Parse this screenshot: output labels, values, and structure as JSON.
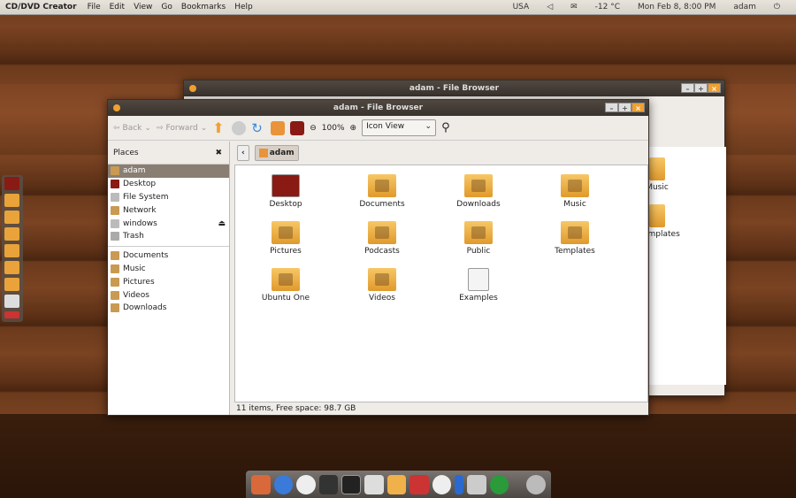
{
  "topbar": {
    "app": "CD/DVD Creator",
    "menus": [
      "File",
      "Edit",
      "View",
      "Go",
      "Bookmarks",
      "Help"
    ],
    "keyboard": "USA",
    "weather": "-12 °C",
    "clock": "Mon Feb  8,  8:00 PM",
    "user": "adam"
  },
  "back_window": {
    "title": "adam - File Browser",
    "items": [
      "Music",
      "Templates"
    ]
  },
  "window": {
    "title": "adam - File Browser",
    "toolbar": {
      "back": "Back",
      "forward": "Forward",
      "zoom": "100%",
      "view": "Icon View"
    },
    "sidebar": {
      "header": "Places",
      "places": [
        "adam",
        "Desktop",
        "File System",
        "Network",
        "windows",
        "Trash"
      ],
      "bookmarks": [
        "Documents",
        "Music",
        "Pictures",
        "Videos",
        "Downloads"
      ]
    },
    "path": "adam",
    "items": [
      "Desktop",
      "Documents",
      "Downloads",
      "Music",
      "Pictures",
      "Podcasts",
      "Public",
      "Templates",
      "Ubuntu One",
      "Videos",
      "Examples"
    ],
    "status": "11 items, Free space: 98.7 GB"
  },
  "colors": {
    "accent": "#f0a030",
    "title_bar": "#3a332d",
    "selection": "#8a7e72"
  }
}
